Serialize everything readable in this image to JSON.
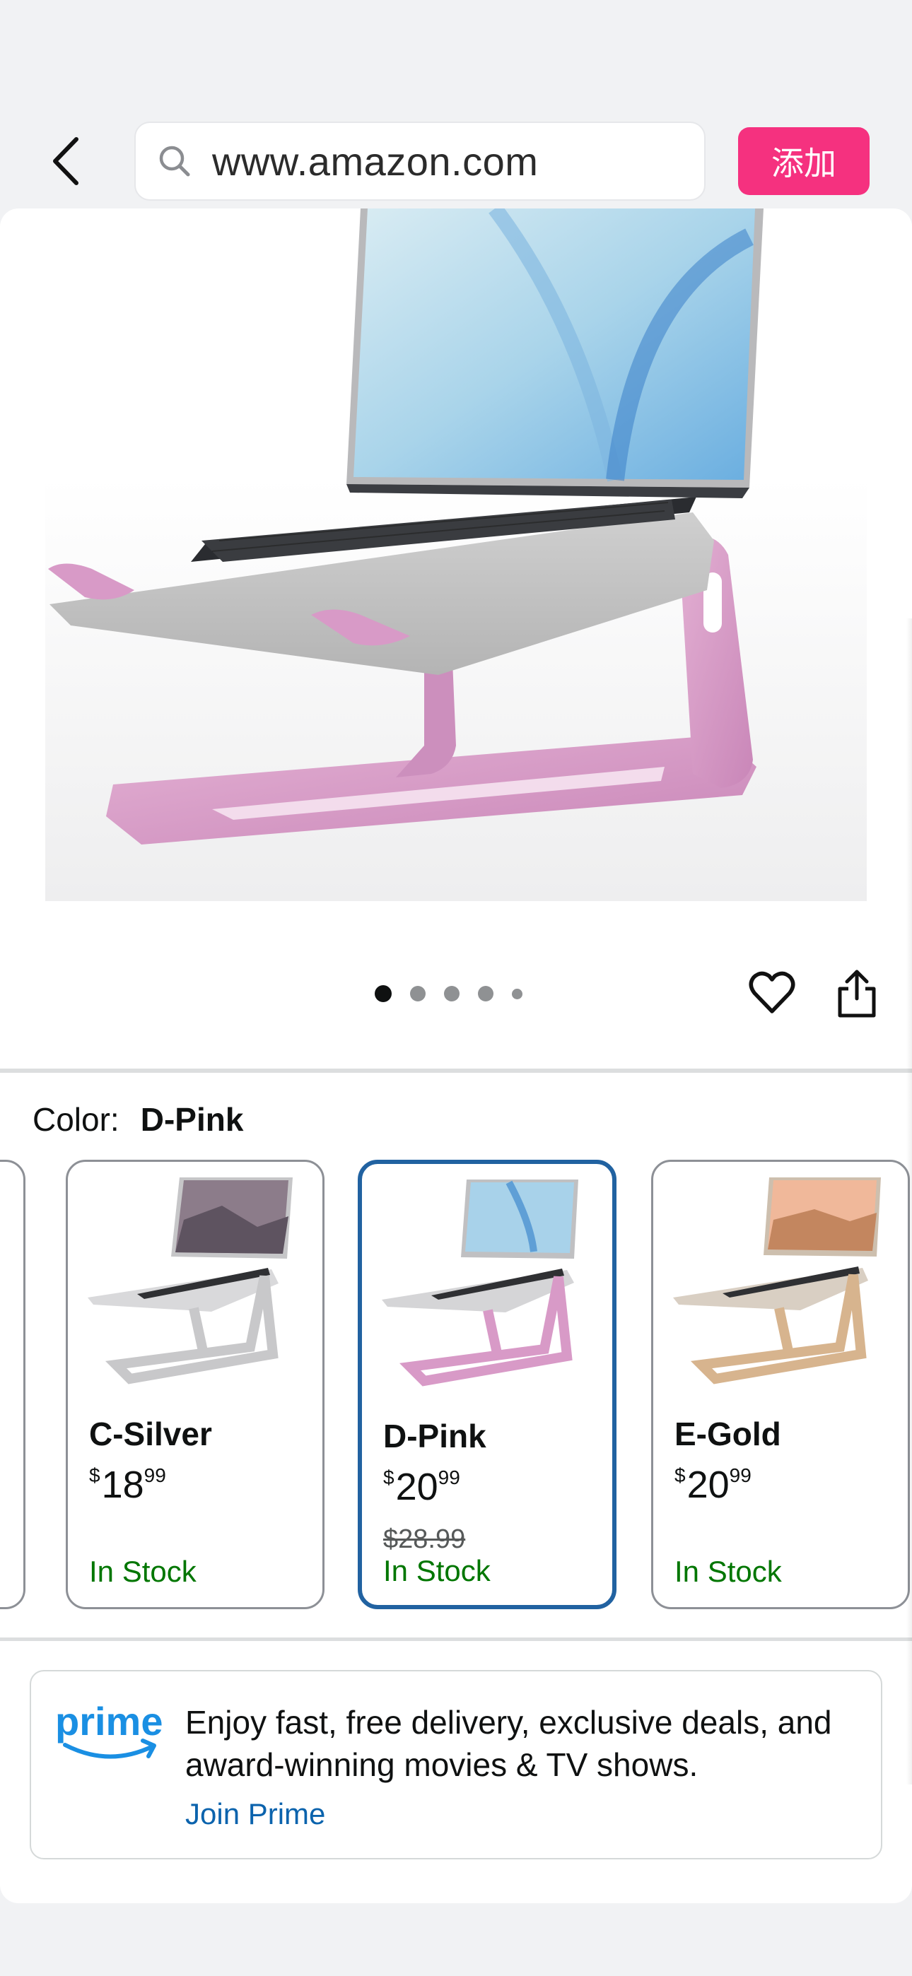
{
  "browser": {
    "url": "www.amazon.com",
    "add_button_label": "添加"
  },
  "gallery": {
    "image_count": 5,
    "active_index": 0
  },
  "color_selector": {
    "label": "Color:",
    "selected": "D-Pink"
  },
  "swatches": [
    {
      "name": "C-Silver",
      "price_symbol": "$",
      "price_whole": "18",
      "price_fraction": "99",
      "stock": "In Stock"
    },
    {
      "name": "D-Pink",
      "price_symbol": "$",
      "price_whole": "20",
      "price_fraction": "99",
      "list_price": "$28.99",
      "stock": "In Stock"
    },
    {
      "name": "E-Gold",
      "price_symbol": "$",
      "price_whole": "20",
      "price_fraction": "99",
      "stock": "In Stock"
    }
  ],
  "prime": {
    "logo_text": "prime",
    "message": "Enjoy fast, free delivery, exclusive deals, and award-winning movies & TV shows.",
    "link_label": "Join Prime"
  },
  "colors": {
    "accent_pink": "#f5317f",
    "selected_border": "#2162a1",
    "in_stock_green": "#007600",
    "link_blue": "#0b63ad",
    "stand_pink": "#d89ac7"
  },
  "icons": [
    "back-chevron-icon",
    "search-icon",
    "heart-icon",
    "share-icon",
    "prime-smile-logo"
  ]
}
